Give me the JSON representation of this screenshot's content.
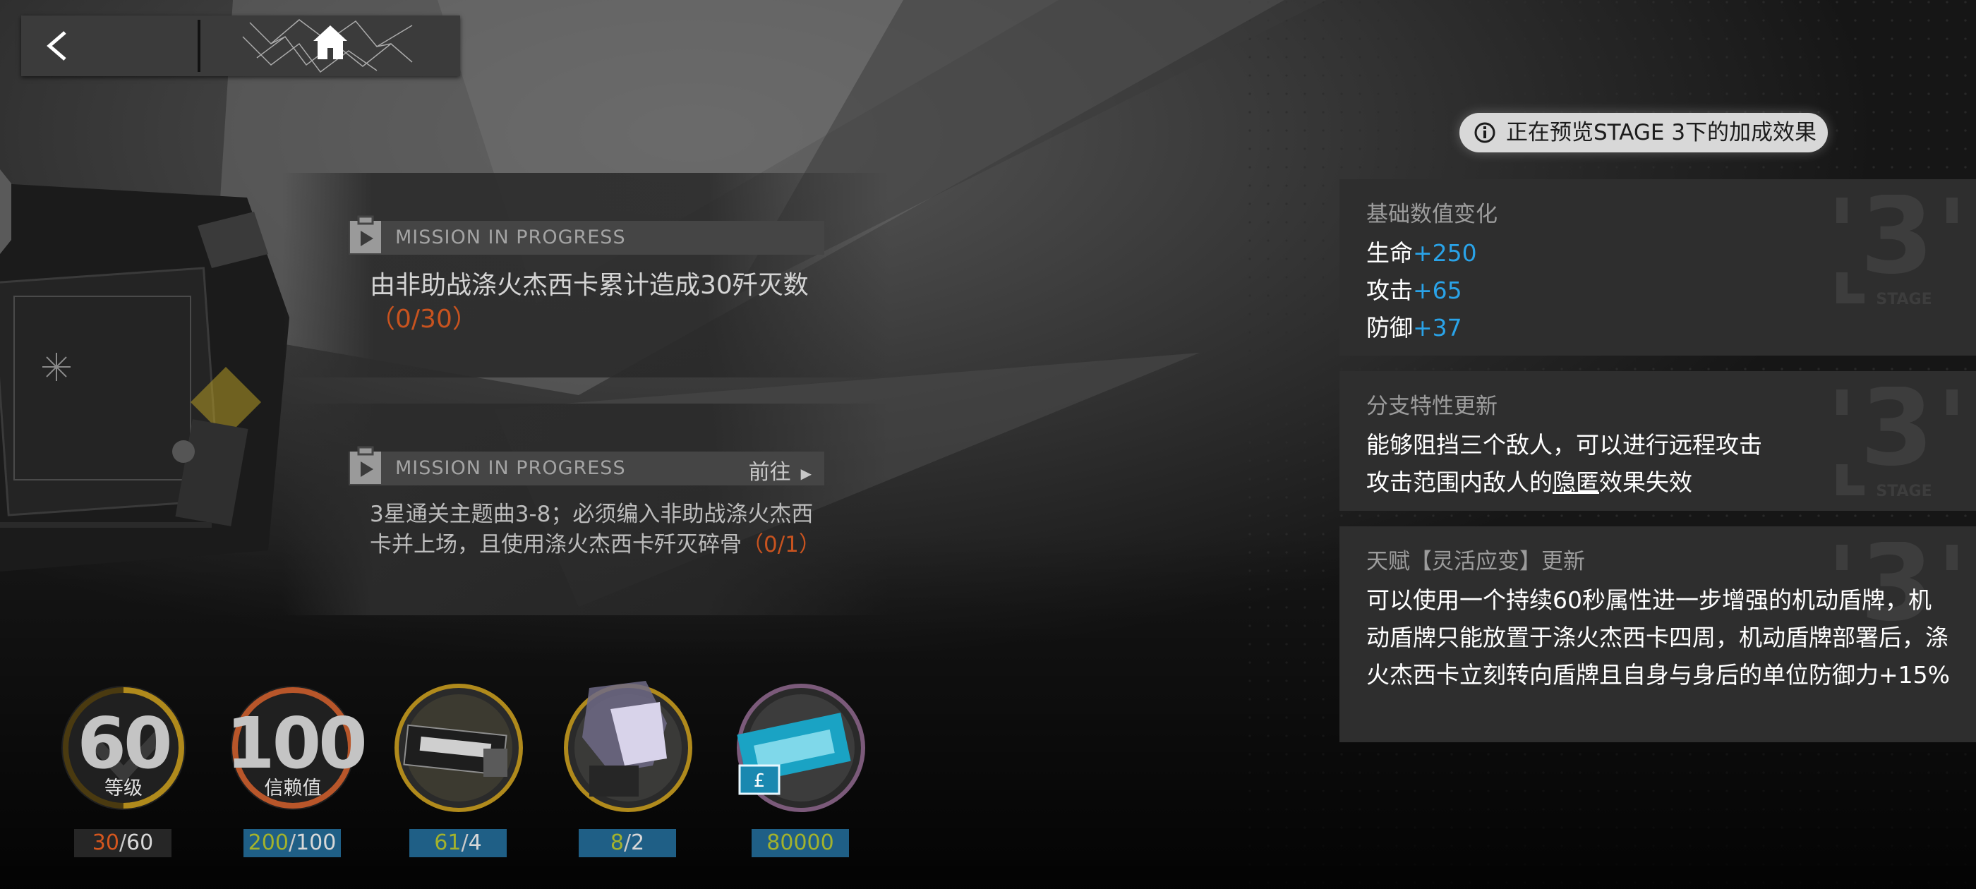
{
  "nav": {
    "back_icon": "chevron-left-icon",
    "home_icon": "home-icon"
  },
  "missions": [
    {
      "status": "MISSION IN PROGRESS",
      "desc": "由非助战涤火杰西卡累计造成30歼灭数",
      "progress": "（0/30）",
      "goto": ""
    },
    {
      "status": "MISSION IN PROGRESS",
      "desc": "3星通关主题曲3-8；必须编入非助战涤火杰西卡并上场，且使用涤火杰西卡歼灭碎骨",
      "progress": "（0/1）",
      "goto": "前往"
    }
  ],
  "stats": [
    {
      "big": "60",
      "small": "等级",
      "val_current": "30",
      "val_sep": "/",
      "val_total": "60",
      "ring_color": "#b08a1c",
      "fill": 0.5
    },
    {
      "big": "100",
      "small": "信赖值",
      "val_current": "200",
      "val_sep": "/",
      "val_total": "100",
      "ring_color": "#b8562a",
      "fill": 1.0
    },
    {
      "val_current": "61",
      "val_sep": "/",
      "val_total": "4",
      "ring_color": "#b08a1c"
    },
    {
      "val_current": "8",
      "val_sep": "/",
      "val_total": "2",
      "ring_color": "#b08a1c"
    },
    {
      "val_current": "80000",
      "ring_color": "#7b5a7a"
    }
  ],
  "preview": {
    "text": "正在预览STAGE 3下的加成效果"
  },
  "cards": {
    "base": {
      "title": "基础数值变化",
      "hp_label": "生命",
      "hp_val": "+250",
      "atk_label": "攻击",
      "atk_val": "+65",
      "def_label": "防御",
      "def_val": "+37"
    },
    "branch": {
      "title": "分支特性更新",
      "line1": "能够阻挡三个敌人，可以进行远程攻击",
      "line2_pre": "攻击范围内敌人的",
      "line2_ul": "隐匿",
      "line2_post": "效果失效"
    },
    "talent": {
      "title": "天赋【灵活应变】更新",
      "body": "可以使用一个持续60秒属性进一步增强的机动盾牌，机动盾牌只能放置于涤火杰西卡四周，机动盾牌部署后，涤火杰西卡立刻转向盾牌且自身与身后的单位防御力+15%"
    },
    "stage_mark_num": "3",
    "stage_mark_word": "STAGE"
  },
  "colors": {
    "accent_blue": "#2aa3e8",
    "progress_orange": "#c8531f",
    "value_bar": "#1f5f86"
  }
}
